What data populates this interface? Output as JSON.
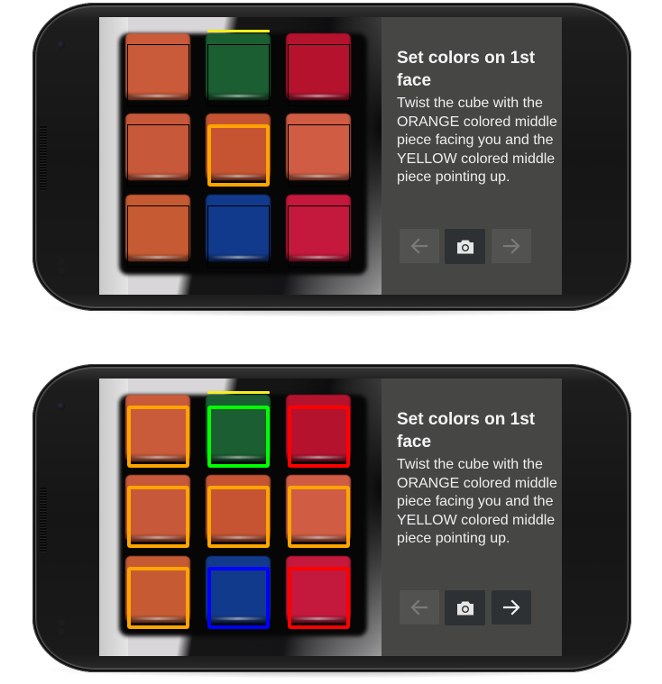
{
  "colors": {
    "orange": "#ffa500",
    "green": "#00ff00",
    "red": "#ff0000",
    "blue": "#0000ff",
    "unset": "#000000",
    "up_indicator": "#f6ef1d",
    "panel_bg": "#464745"
  },
  "cube_stickers": [
    [
      "#c95a3a",
      "#1a5e32",
      "#b5122e"
    ],
    [
      "#c8583a",
      "#c65433",
      "#d05c44"
    ],
    [
      "#c65a33",
      "#123a8c",
      "#c4183c"
    ]
  ],
  "screens": [
    {
      "panel": {
        "title": "Set colors on 1st face",
        "instructions": "Twist the cube with the ORANGE colored middle piece facing you and the YELLOW colored middle piece pointing up."
      },
      "buttons": {
        "prev": {
          "icon": "arrow-left-icon",
          "enabled": false
        },
        "shutter": {
          "icon": "camera-icon",
          "enabled": true
        },
        "next": {
          "icon": "arrow-right-icon",
          "enabled": false
        }
      },
      "detected_colors": [
        [
          "unset",
          "unset",
          "unset"
        ],
        [
          "unset",
          "orange",
          "unset"
        ],
        [
          "unset",
          "unset",
          "unset"
        ]
      ]
    },
    {
      "panel": {
        "title": "Set colors on 1st face",
        "instructions": "Twist the cube with the ORANGE colored middle piece facing you and the YELLOW colored middle piece pointing up."
      },
      "buttons": {
        "prev": {
          "icon": "arrow-left-icon",
          "enabled": false
        },
        "shutter": {
          "icon": "camera-icon",
          "enabled": true
        },
        "next": {
          "icon": "arrow-right-icon",
          "enabled": true
        }
      },
      "detected_colors": [
        [
          "orange",
          "green",
          "red"
        ],
        [
          "orange",
          "orange",
          "orange"
        ],
        [
          "orange",
          "blue",
          "red"
        ]
      ]
    }
  ]
}
